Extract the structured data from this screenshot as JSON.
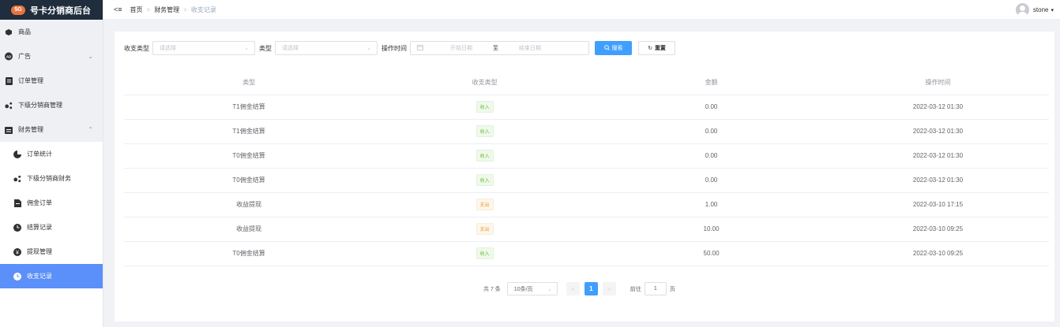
{
  "app": {
    "title": "号卡分销商后台",
    "badge": "5G"
  },
  "sidebar": {
    "items": [
      {
        "label": "商品",
        "icon": "goods-icon"
      },
      {
        "label": "广告",
        "icon": "ad-icon"
      },
      {
        "label": "订单管理",
        "icon": "order-icon"
      },
      {
        "label": "下级分销商管理",
        "icon": "share-icon"
      },
      {
        "label": "财务管理",
        "icon": "finance-icon"
      }
    ],
    "sub_items": [
      {
        "label": "订单统计",
        "icon": "pie-chart-icon"
      },
      {
        "label": "下级分销商财务",
        "icon": "share-icon"
      },
      {
        "label": "佣金订单",
        "icon": "document-icon"
      },
      {
        "label": "结算记录",
        "icon": "clock-icon"
      },
      {
        "label": "提现管理",
        "icon": "withdraw-icon"
      },
      {
        "label": "收支记录",
        "icon": "clock-icon"
      }
    ],
    "active": "收支记录"
  },
  "topbar": {
    "toggle": "<≡",
    "breadcrumb": [
      "首页",
      "财务管理",
      "收支记录"
    ],
    "username": "stone"
  },
  "filters": {
    "type_label": "收支类型",
    "type_placeholder": "请选择",
    "kind_label": "类型",
    "kind_placeholder": "请选择",
    "time_label": "操作时间",
    "start_placeholder": "开始日期",
    "range_sep": "至",
    "end_placeholder": "结束日期",
    "search_label": "搜索",
    "reset_label": "重置"
  },
  "table": {
    "headers": [
      "类型",
      "收支类型",
      "金额",
      "操作时间"
    ],
    "rows": [
      {
        "type": "T1佣金结算",
        "io": "收入",
        "io_kind": "in",
        "amount": "0.00",
        "time": "2022-03-12 01:30"
      },
      {
        "type": "T1佣金结算",
        "io": "收入",
        "io_kind": "in",
        "amount": "0.00",
        "time": "2022-03-12 01:30"
      },
      {
        "type": "T0佣金结算",
        "io": "收入",
        "io_kind": "in",
        "amount": "0.00",
        "time": "2022-03-12 01:30"
      },
      {
        "type": "T0佣金结算",
        "io": "收入",
        "io_kind": "in",
        "amount": "0.00",
        "time": "2022-03-12 01:30"
      },
      {
        "type": "收益提现",
        "io": "支出",
        "io_kind": "out",
        "amount": "1.00",
        "time": "2022-03-10 17:15"
      },
      {
        "type": "收益提现",
        "io": "支出",
        "io_kind": "out",
        "amount": "10.00",
        "time": "2022-03-10 09:25"
      },
      {
        "type": "T0佣金结算",
        "io": "收入",
        "io_kind": "in",
        "amount": "50.00",
        "time": "2022-03-10 09:25"
      }
    ]
  },
  "pagination": {
    "total": "共 7 条",
    "page_size": "10条/页",
    "current": "1",
    "goto_label": "前往",
    "goto_value": "1",
    "page_suffix": "页"
  },
  "colors": {
    "primary": "#409eff",
    "menu_active": "#5b8ff9",
    "logo_bg": "#1f2d3d",
    "income": "#67c23a",
    "expense": "#e6a23c"
  }
}
